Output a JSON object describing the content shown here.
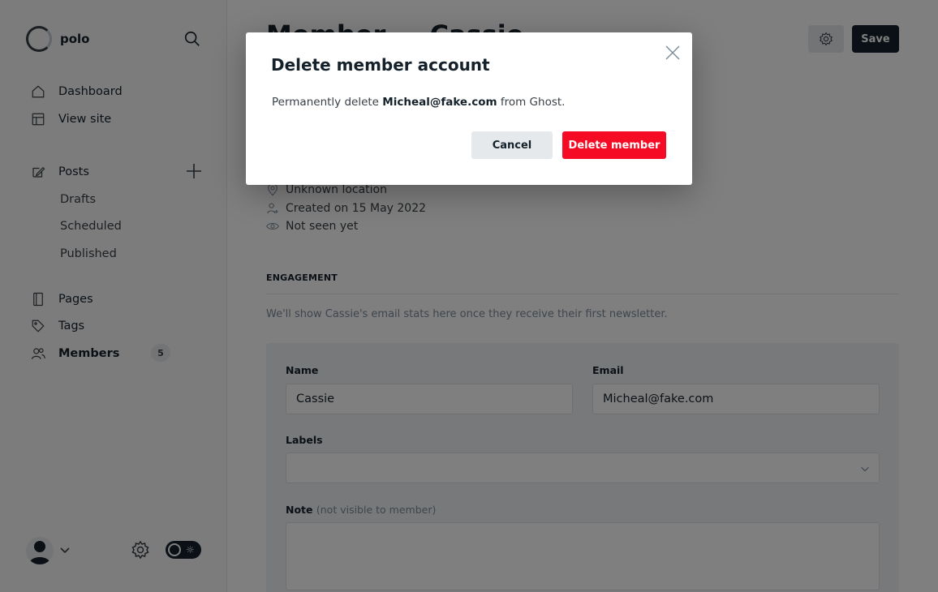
{
  "sidebar": {
    "brand": {
      "name": "polo"
    },
    "nav": {
      "dashboard": "Dashboard",
      "view_site": "View site",
      "posts": "Posts",
      "drafts": "Drafts",
      "scheduled": "Scheduled",
      "published": "Published",
      "pages": "Pages",
      "tags": "Tags",
      "members": "Members",
      "members_count": "5"
    }
  },
  "header": {
    "title": "Member — Cassie",
    "save_label": "Save"
  },
  "member_meta": {
    "location": "Unknown location",
    "created": "Created on 15 May 2022",
    "seen": "Not seen yet"
  },
  "engagement": {
    "label": "ENGAGEMENT",
    "text": "We'll show Cassie's email stats here once they receive their first newsletter."
  },
  "form": {
    "name_label": "Name",
    "name_value": "Cassie",
    "email_label": "Email",
    "email_value": "Micheal@fake.com",
    "labels_label": "Labels",
    "note_label": "Note",
    "note_hint": "(not visible to member)"
  },
  "modal": {
    "title": "Delete member account",
    "body_prefix": "Permanently delete ",
    "body_email": "Micheal@fake.com",
    "body_suffix": " from Ghost.",
    "cancel_label": "Cancel",
    "delete_label": "Delete member"
  },
  "colors": {
    "danger": "#f50b23",
    "primary_dark": "#15212a",
    "overlay": "rgba(0,0,0,0.5)"
  },
  "icons": [
    "search-icon",
    "home-icon",
    "view-site-icon",
    "posts-icon",
    "plus-icon",
    "pages-icon",
    "tags-icon",
    "members-icon",
    "location-icon",
    "user-created-icon",
    "eye-icon",
    "gear-icon",
    "chevron-down-icon",
    "close-icon",
    "sun-icon",
    "avatar-icon"
  ]
}
